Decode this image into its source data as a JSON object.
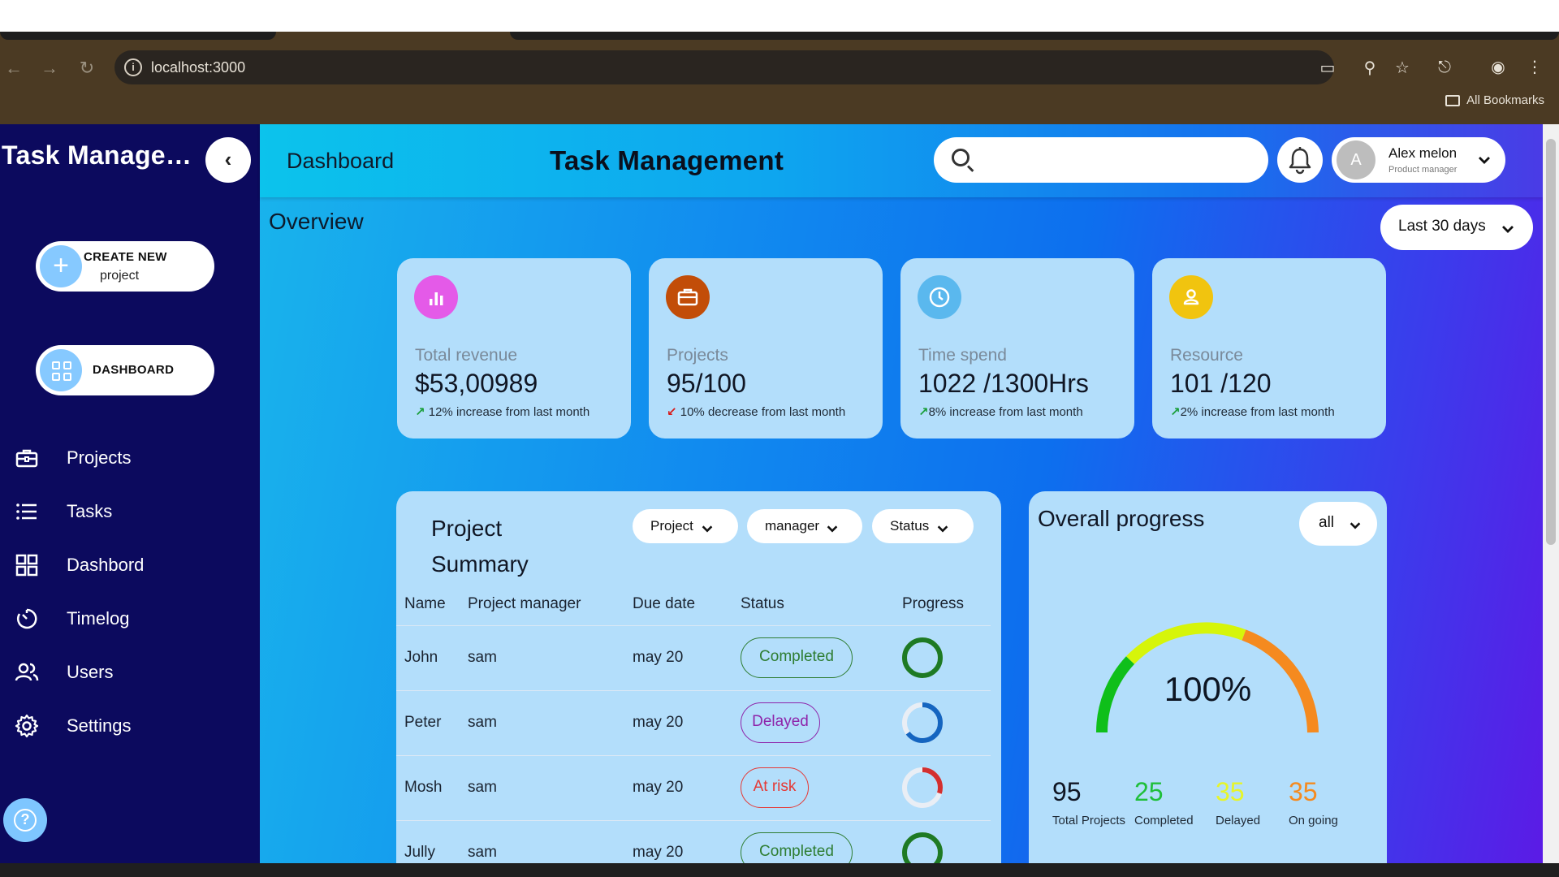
{
  "browser": {
    "url": "localhost:3000",
    "bookmarks_label": "All Bookmarks"
  },
  "sidebar": {
    "title": "Task Manage…",
    "create_line1": "CREATE NEW",
    "create_line2": "project",
    "dashboard_button": "DASHBOARD",
    "items": [
      {
        "label": "Projects",
        "icon": "briefcase-icon"
      },
      {
        "label": "Tasks",
        "icon": "list-icon"
      },
      {
        "label": "Dashbord",
        "icon": "grid-icon"
      },
      {
        "label": "Timelog",
        "icon": "timer-icon"
      },
      {
        "label": "Users",
        "icon": "users-icon"
      },
      {
        "label": "Settings",
        "icon": "gear-icon"
      }
    ]
  },
  "header": {
    "breadcrumb": "Dashboard",
    "title": "Task Management",
    "search_placeholder": "",
    "user_name": "Alex melon",
    "user_role": "Product manager",
    "user_initial": "A"
  },
  "overview": {
    "title": "Overview",
    "period": "Last 30 days"
  },
  "cards": [
    {
      "label": "Total revenue",
      "value": "$53,00989",
      "note": "12% increase from last month",
      "trend": "up",
      "icon": "bar-chart-icon",
      "color": "#e45ae8"
    },
    {
      "label": "Projects",
      "value": "95/100",
      "note": "10% decrease from last month",
      "trend": "down",
      "icon": "briefcase-icon",
      "color": "#c24d08"
    },
    {
      "label": "Time spend",
      "value": "1022 /1300Hrs",
      "note": "8% increase from last month",
      "trend": "up",
      "icon": "clock-icon",
      "color": "#5ab8ee"
    },
    {
      "label": "Resource",
      "value": "101 /120",
      "note": "2% increase from last month",
      "trend": "up",
      "icon": "user-icon",
      "color": "#f1c40f"
    }
  ],
  "summary": {
    "title": "Project Summary",
    "filters": [
      "Project",
      "manager",
      "Status"
    ],
    "columns": [
      "Name",
      "Project manager",
      "Due date",
      "Status",
      "Progress"
    ],
    "rows": [
      {
        "name": "John",
        "manager": "sam",
        "due": "may 20",
        "status": "Completed",
        "progress": 1.0
      },
      {
        "name": "Peter",
        "manager": "sam",
        "due": "may 20",
        "status": "Delayed",
        "progress": 0.65
      },
      {
        "name": "Mosh",
        "manager": "sam",
        "due": "may 20",
        "status": "At risk",
        "progress": 0.3
      },
      {
        "name": "Jully",
        "manager": "sam",
        "due": "may 20",
        "status": "Completed",
        "progress": 1.0
      }
    ],
    "status_colors": {
      "Completed": "#2e7d32",
      "Delayed": "#8e24aa",
      "At risk": "#e53935"
    }
  },
  "progress": {
    "title": "Overall progress",
    "filter": "all",
    "value": "100%",
    "stats": [
      {
        "value": "95",
        "label": "Total Projects",
        "color": "#101624"
      },
      {
        "value": "25",
        "label": "Completed",
        "color": "#1fbf3a"
      },
      {
        "value": "35",
        "label": "Delayed",
        "color": "#e6f52a"
      },
      {
        "value": "35",
        "label": "On going",
        "color": "#f58a1f"
      }
    ]
  }
}
